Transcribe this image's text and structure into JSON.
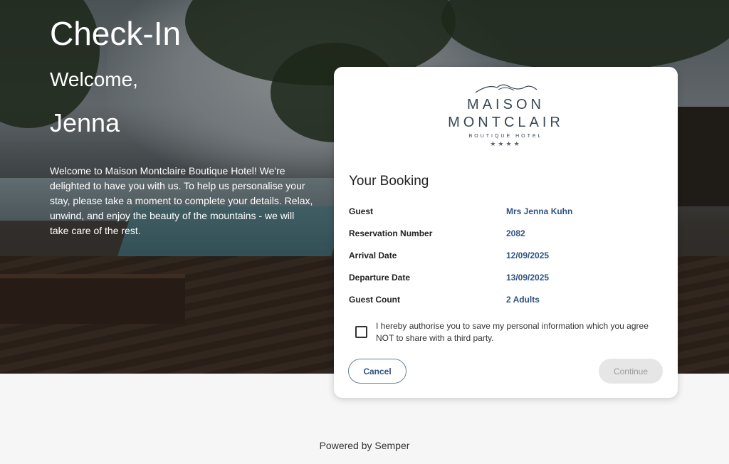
{
  "hero": {
    "title": "Check-In",
    "welcome": "Welcome,",
    "guest_first_name": "Jenna",
    "intro": "Welcome to Maison Montclaire Boutique Hotel! We're delighted to have you with us. To help us personalise your stay, please take a moment to complete your details. Relax, unwind, and enjoy the beauty of the mountains - we will take care of the rest."
  },
  "logo": {
    "line1": "MAISON",
    "line2": "MONTCLAIR",
    "line3": "BOUTIQUE HOTEL",
    "stars": "★★★★"
  },
  "booking": {
    "title": "Your Booking",
    "rows": [
      {
        "label": "Guest",
        "value": "Mrs Jenna Kuhn"
      },
      {
        "label": "Reservation Number",
        "value": "2082"
      },
      {
        "label": "Arrival Date",
        "value": "12/09/2025"
      },
      {
        "label": "Departure Date",
        "value": "13/09/2025"
      },
      {
        "label": "Guest Count",
        "value": "2 Adults"
      }
    ]
  },
  "consent": {
    "checked": false,
    "text": "I hereby authorise you to save my personal information which you agree NOT to share with a third party."
  },
  "actions": {
    "cancel_label": "Cancel",
    "continue_label": "Continue",
    "continue_disabled": true
  },
  "footer": {
    "text": "Powered by Semper"
  },
  "colors": {
    "accent": "#2f5380",
    "logo": "#3b4654",
    "disabled_bg": "#e6e6e6"
  },
  "icons": {
    "logo_mark": "mountain-icon",
    "checkbox": "checkbox-icon"
  }
}
